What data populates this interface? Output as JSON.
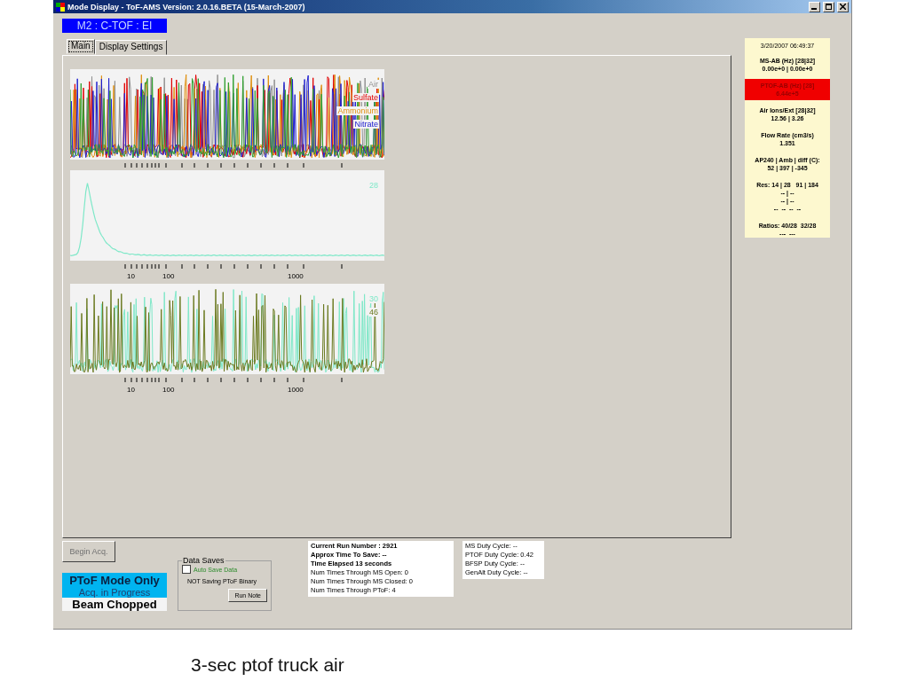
{
  "window": {
    "title": "Mode Display - ToF-AMS Version: 2.0.16.BETA (15-March-2007)"
  },
  "mode_label": "M2 : C-TOF : EI",
  "tabs": [
    {
      "label": "Main",
      "selected": true
    },
    {
      "label": "Display Settings",
      "selected": false
    }
  ],
  "charts": [
    {
      "legend": [
        {
          "label": "Air",
          "color": "#909090"
        },
        {
          "label": "Sulfate",
          "color": "#e00000"
        },
        {
          "label": "Ammonium",
          "color": "#e09010"
        },
        {
          "label": "Nitrate",
          "color": "#2020d0"
        }
      ]
    },
    {
      "legend": [
        {
          "label": "28",
          "color": "#7ee8c8"
        }
      ],
      "tick_labels": [
        "10",
        "100",
        "1000"
      ]
    },
    {
      "legend": [
        {
          "label": "30",
          "color": "#7ee8c8"
        },
        {
          "label": "46",
          "color": "#6b7a20"
        }
      ],
      "tick_labels": [
        "10",
        "100",
        "1000"
      ]
    }
  ],
  "status_panel": {
    "timestamp": "3/20/2007 06:49:37",
    "items": [
      {
        "lines": [
          "MS-AB (Hz) [28|32]",
          "0.00e+0 | 0.00e+0"
        ],
        "alert": false
      },
      {
        "lines": [
          "PTOF-AB (Hz) [28]",
          "6.44e+5"
        ],
        "alert": true
      },
      {
        "lines": [
          "Air Ions/Ext [28|32]",
          "12.56 | 3.26"
        ],
        "alert": false
      },
      {
        "lines": [
          "Flow Rate (cm3/s)",
          "1.351"
        ],
        "alert": false
      },
      {
        "lines": [
          "AP240 | Amb | diff (C):",
          "52 | 397 | -345"
        ],
        "alert": false
      },
      {
        "lines": [
          "Res: 14 | 28   91 | 184",
          "-- | --",
          "-- | --",
          "--  --  --  --"
        ],
        "alert": false
      },
      {
        "lines": [
          "Ratios: 40/28  32/28",
          "---  ---"
        ],
        "alert": false
      }
    ]
  },
  "begin_button": {
    "label": "Begin Acq.",
    "disabled": true
  },
  "mode_status": {
    "mode": "PToF Mode Only",
    "acquisition": "Acq. in Progress",
    "beam": "Beam Chopped"
  },
  "data_saves": {
    "title": "Data Saves",
    "auto_save": {
      "label": "Auto Save Data",
      "checked": false
    },
    "status": "NOT Saving PToF Binary",
    "button": "Run Note"
  },
  "run_info": [
    {
      "text": "Current Run Number : 2921",
      "bold": true
    },
    {
      "text": "Approx Time To Save: --",
      "bold": true
    },
    {
      "text": "Time Elapsed 13 seconds",
      "bold": true
    },
    {
      "text": "Num Times Through MS Open: 0",
      "bold": false
    },
    {
      "text": "Num Times Through MS Closed: 0",
      "bold": false
    },
    {
      "text": "Num Times Through PToF: 4",
      "bold": false
    }
  ],
  "duty_cycles": [
    "MS Duty Cycle: --",
    "PTOF Duty Cycle: 0.42",
    "BFSP Duty Cycle: --",
    "GenAlt Duty Cycle: --"
  ],
  "caption": "3-sec ptof truck air"
}
